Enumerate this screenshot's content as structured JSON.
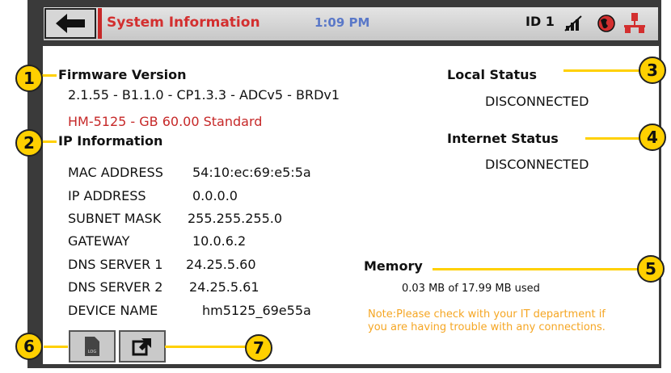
{
  "header": {
    "title": "System Information",
    "time": "1:09 PM",
    "id_label": "ID 1"
  },
  "firmware": {
    "heading": "Firmware Version",
    "version": "2.1.55 - B1.1.0 - CP1.3.3 - ADCv5 - BRDv1",
    "model": "HM-5125 - GB 60.00 Standard"
  },
  "ip": {
    "heading": "IP Information",
    "rows": [
      {
        "label": "MAC ADDRESS",
        "value": "54:10:ec:69:e5:5a"
      },
      {
        "label": "IP ADDRESS",
        "value": "0.0.0.0"
      },
      {
        "label": "SUBNET MASK",
        "value": "255.255.255.0"
      },
      {
        "label": "GATEWAY",
        "value": "10.0.6.2"
      },
      {
        "label": "DNS SERVER 1",
        "value": "24.25.5.60"
      },
      {
        "label": "DNS SERVER 2",
        "value": "24.25.5.61"
      },
      {
        "label": "DEVICE NAME",
        "value": "hm5125_69e55a"
      }
    ]
  },
  "local_status": {
    "heading": "Local Status",
    "value": "DISCONNECTED"
  },
  "internet_status": {
    "heading": "Internet Status",
    "value": "DISCONNECTED"
  },
  "memory": {
    "heading": "Memory",
    "usage": "0.03 MB of 17.99 MB used"
  },
  "note": "Note:Please check with your IT department if you are having trouble with any connections.",
  "buttons": {
    "log_icon_text": "LOG"
  },
  "callouts": [
    "1",
    "2",
    "3",
    "4",
    "5",
    "6",
    "7"
  ],
  "colors": {
    "accent_red": "#d32f2f",
    "time_blue": "#5a78c8",
    "callout_yellow": "#ffd000",
    "note_orange": "#f5a623"
  }
}
